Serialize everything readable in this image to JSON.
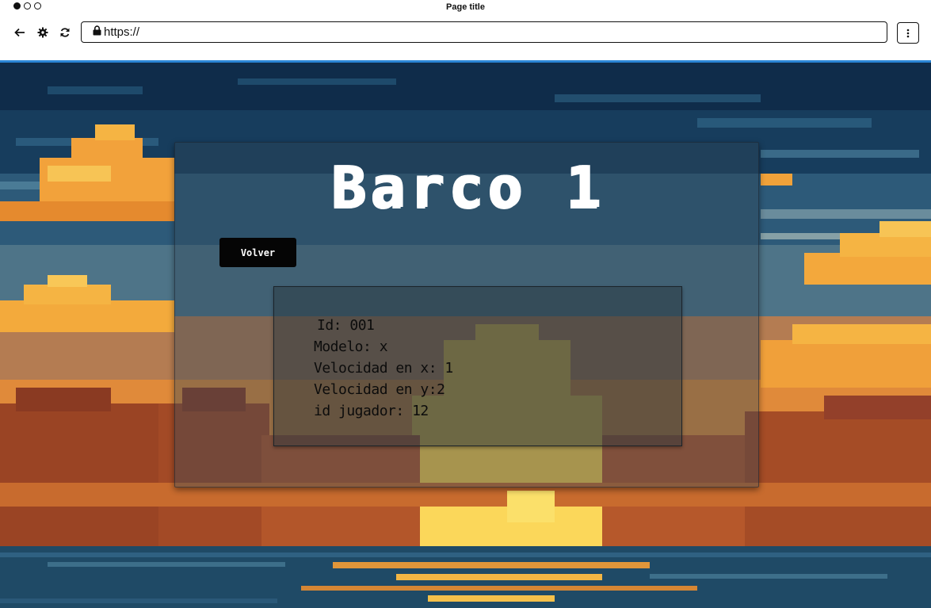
{
  "browser": {
    "title": "Page title",
    "url": "https://",
    "icons": {
      "back": "arrow-left-icon",
      "settings": "gear-icon",
      "reload": "reload-icon",
      "lock": "lock-icon",
      "menu": "kebab-menu-icon"
    }
  },
  "page": {
    "heading": "Barco 1",
    "back_button_label": "Volver",
    "details": [
      {
        "label": "Id:",
        "value": "001"
      },
      {
        "label": "Modelo:",
        "value": "x"
      },
      {
        "label": "Velocidad en x:",
        "value": "1"
      },
      {
        "label": "Velocidad en y:",
        "value": "2"
      },
      {
        "label": "id jugador:",
        "value": "12"
      }
    ]
  },
  "colors": {
    "accent_line": "#2b86d6",
    "button_bg": "#050505",
    "title_text": "#ffffff"
  }
}
